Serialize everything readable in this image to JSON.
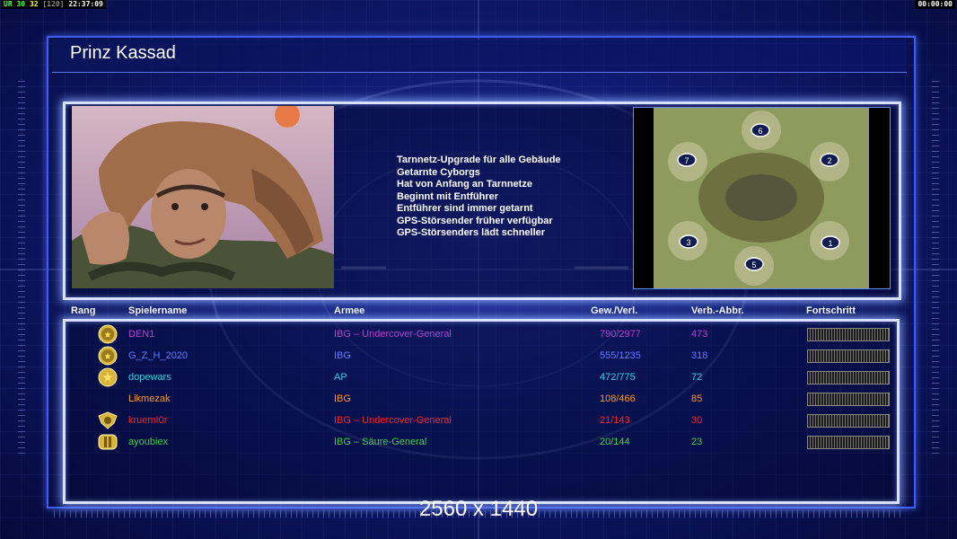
{
  "topbar": {
    "left_ur": "UR",
    "left_fps1": "30",
    "left_fps2": "32",
    "left_limit": "[120]",
    "left_time": "22:37:09",
    "right_time": "00:00:00"
  },
  "general": {
    "name": "Prinz Kassad",
    "traits": [
      "Tarnnetz-Upgrade für alle Gebäude",
      "Getarnte Cyborgs",
      "Hat von Anfang an Tarnnetze",
      "Beginnt mit Entführer",
      "Entführer sind immer getarnt",
      "GPS-Störsender früher verfügbar",
      "GPS-Störsenders lädt schneller"
    ]
  },
  "minimap": {
    "start_positions": [
      "6",
      "7",
      "2",
      "3",
      "1",
      "5"
    ]
  },
  "table": {
    "headers": {
      "rank": "Rang",
      "player": "Spielername",
      "army": "Armee",
      "winloss": "Gew./Verl.",
      "disconnects": "Verb.-Abbr.",
      "progress": "Fortschritt"
    },
    "rows": [
      {
        "player": "DEN1",
        "army": "IBG – Undercover-General",
        "winloss": "790/2977",
        "disc": "473",
        "color": "#b040d0",
        "rank_icon": "double-star-medal-icon",
        "progress": 0
      },
      {
        "player": "G_Z_H_2020",
        "army": "IBG",
        "winloss": "555/1235",
        "disc": "318",
        "color": "#5a7cff",
        "rank_icon": "double-star-medal-icon",
        "progress": 0
      },
      {
        "player": "dopewars",
        "army": "AP",
        "winloss": "472/775",
        "disc": "72",
        "color": "#30d0e0",
        "rank_icon": "star-medal-icon",
        "progress": 0
      },
      {
        "player": "Likmezak",
        "army": "IBG",
        "winloss": "108/466",
        "disc": "85",
        "color": "#ff9a1a",
        "rank_icon": "",
        "progress": 0
      },
      {
        "player": "kruemI0r",
        "army": "IBG – Undercover-General",
        "winloss": "21/143",
        "disc": "30",
        "color": "#ff2020",
        "rank_icon": "eagle-medal-icon",
        "progress": 0
      },
      {
        "player": "ayoubiex",
        "army": "IBG – Säure-General",
        "winloss": "20/144",
        "disc": "23",
        "color": "#40d040",
        "rank_icon": "bars-medal-icon",
        "progress": 0
      }
    ]
  },
  "resolution_text": "2560 x 1440"
}
